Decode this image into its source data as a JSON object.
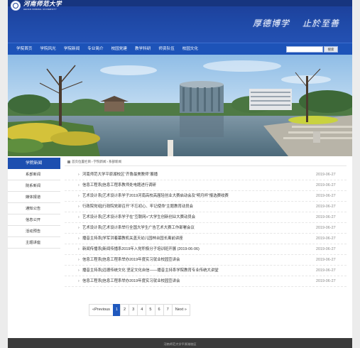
{
  "header": {
    "logo_cn": "河南师范大学",
    "logo_en": "HENAN NORMAL UNIVERSITY",
    "motto_1": "厚德博学",
    "motto_2": "止於至善"
  },
  "nav": {
    "items": [
      "学院首页",
      "学院风光",
      "学院新闻",
      "专业简介",
      "校园党建",
      "教学科研",
      "师资队伍",
      "校园文化"
    ],
    "search_placeholder": "",
    "search_button": "搜索"
  },
  "sidebar": {
    "heading": "学院新闻",
    "items": [
      "系部新闻",
      "院系新闻",
      "媒体报道",
      "通知公告",
      "信息公开",
      "活动预告",
      "主题讲座"
    ]
  },
  "breadcrumb": {
    "items": [
      "首页位置栏目",
      "学院新闻",
      "系部新闻"
    ]
  },
  "news": [
    {
      "title": "河南师范大学平原湖校区“齐鲁最美教师”展播",
      "date": "2019-06-27"
    },
    {
      "title": "信息工程系]信息工程系教师处电题进行调研",
      "date": "2019-06-27"
    },
    {
      "title": "艺术设计系]艺术设计系学子2019河南高校高届轻创业大赛启动会及“明月杯”报选赛收赛",
      "date": "2019-06-27"
    },
    {
      "title": "行政院党组]行政院党部召开“不忘初心、牢记使命”主题教育动员会",
      "date": "2019-06-27"
    },
    {
      "title": "艺术设计系]艺术设计系学子在“互联网+”大学生创新创业大赛动员会",
      "date": "2019-06-27"
    },
    {
      "title": "艺术设计系]艺术设计系举行全国大学生广告艺术大赛工作部署会议",
      "date": "2019-06-27"
    },
    {
      "title": "播音主持系]学军洪着幕教机关盖天幼儿园林台园长离前讲座",
      "date": "2019-06-27"
    },
    {
      "title": "新闻传播系]新闻传播系2019年入党积极分子培训班开展 (2019-06-06)",
      "date": "2019-06-27"
    },
    {
      "title": "信息工程系]信息工程系举办2019年度实习就业校园宣讲会",
      "date": "2019-06-27"
    },
    {
      "title": "播音主持系]远德传统文化 坚定文化自信——播音主持系学院教育专业传统大讲堂",
      "date": "2019-06-27"
    },
    {
      "title": "信息工程系]信息工程系举办2019年度实习就业校园宣讲会",
      "date": "2019-06-27"
    }
  ],
  "pager": {
    "prev": "«Previous",
    "pages": [
      "1",
      "2",
      "3",
      "4",
      "5",
      "6",
      "7"
    ],
    "current": "1",
    "next": "Next »"
  },
  "footer": {
    "text": "河南师范大学平原湖校区"
  },
  "colors": {
    "brand_blue": "#1d53b8",
    "header_blue": "#1f4aa8",
    "footer": "#3b3b3b"
  }
}
